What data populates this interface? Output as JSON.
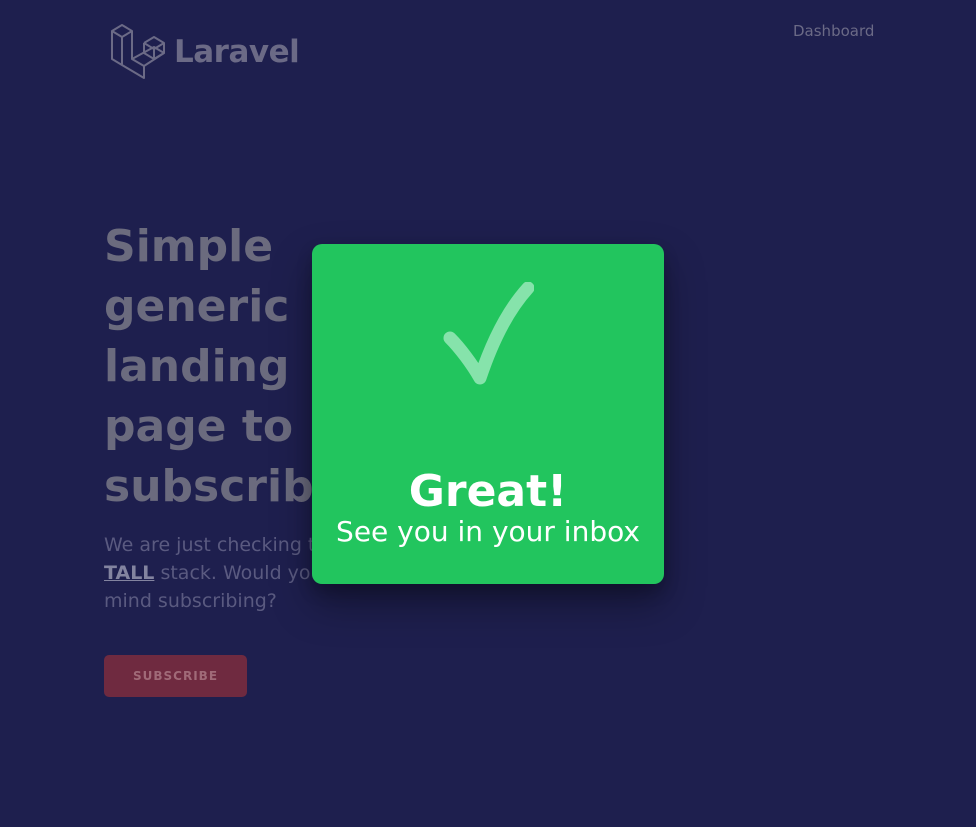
{
  "header": {
    "logo_text": "Laravel",
    "nav": {
      "dashboard_label": "Dashboard"
    }
  },
  "hero": {
    "title_lines": [
      "Simple",
      "generic",
      "landing",
      "page to",
      "subscribe"
    ],
    "description": {
      "line1": "We are just checking the",
      "line2_link": "TALL",
      "line2_rest": " stack. Would you",
      "line3": "mind subscribing?"
    },
    "subscribe_label": "Subscribe"
  },
  "modal": {
    "icon": "checkmark-icon",
    "title": "Great!",
    "subtitle": "See you in your inbox"
  },
  "colors": {
    "background": "#1e1f4e",
    "modal": "#22c55e",
    "subscribe_button": "#6f2a40"
  }
}
